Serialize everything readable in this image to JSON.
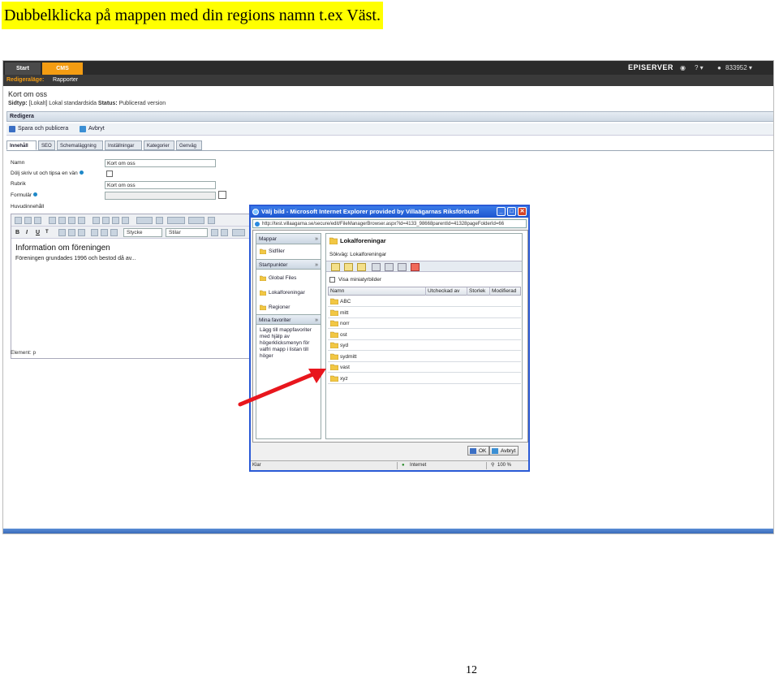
{
  "heading": "Dubbelklicka på mappen med din regions namn t.ex Väst.",
  "page_number": "12",
  "cms": {
    "top_tabs": [
      "Start",
      "CMS"
    ],
    "brand": "EPISERVER",
    "help_label": "? ▾",
    "user_label": "833952 ▾",
    "mode_label": "Redigeraläge:",
    "reports_label": "Rapporter",
    "page_title": "Kort om oss",
    "page_meta_prefix": "Sidtyp:",
    "page_meta_type": "[Lokalt] Lokal standardsida",
    "page_meta_status_label": "Status:",
    "page_meta_status": "Publicerad version",
    "edit_label": "Redigera",
    "save_publish": "Spara och publicera",
    "cancel": "Avbryt",
    "tabs": [
      "Innehåll",
      "SEO",
      "Schemaläggning",
      "Inställningar",
      "Kategorier",
      "Genväg"
    ],
    "fields": {
      "name_label": "Namn",
      "name_value": "Kort om oss",
      "hide_label": "Dölj skriv ut och tipsa en vän",
      "heading_label": "Rubrik",
      "heading_value": "Kort om oss",
      "form_label": "Formulär",
      "main_label": "Huvudinnehåll"
    },
    "editor": {
      "bold": "B",
      "italic": "I",
      "underline": "U",
      "style_select": "Stycke",
      "format_select": "Stilar",
      "heading_text": "Information om föreningen",
      "body_text": "Föreningen grundades 1996 och bestod då av...",
      "status": "Element: p"
    }
  },
  "dialog": {
    "title": "Välj bild - Microsoft Internet Explorer provided by Villaägarnas Riksförbund",
    "address": "http://test.villaagarna.se/secure/edit/FileManagerBrowser.aspx?id=4133_98668parentId=41328pageFolderId=66",
    "left": {
      "folders_header": "Mappar",
      "page_files": "Sidfiler",
      "start_header": "Startpunkter",
      "global_files": "Global Files",
      "local_assoc": "Lokalforeningar",
      "regions": "Regioner",
      "favorites_header": "Mina favoriter",
      "favorites_help": "Lägg till mappfavoriter med hjälp av högerklicksmenyn för valfri mapp i listan till höger"
    },
    "right": {
      "title": "Lokalforeningar",
      "path": "Sökväg: Lokalforeningar",
      "show_thumbs": "Visa miniatyrbilder",
      "columns": [
        "Namn",
        "Utcheckad av",
        "Storlek",
        "Modifierad"
      ],
      "folders": [
        "ABC",
        "mitt",
        "norr",
        "ost",
        "syd",
        "sydmitt",
        "vast",
        "xyz"
      ]
    },
    "ok": "OK",
    "cancel": "Avbryt",
    "status_left": "Klar",
    "status_zone": "Internet",
    "status_zoom": "100 %"
  },
  "colors": {
    "highlight": "#ffff00",
    "cms_orange": "#f39c12",
    "dialog_blue": "#2a5ad6",
    "arrow_red": "#e8161d"
  }
}
